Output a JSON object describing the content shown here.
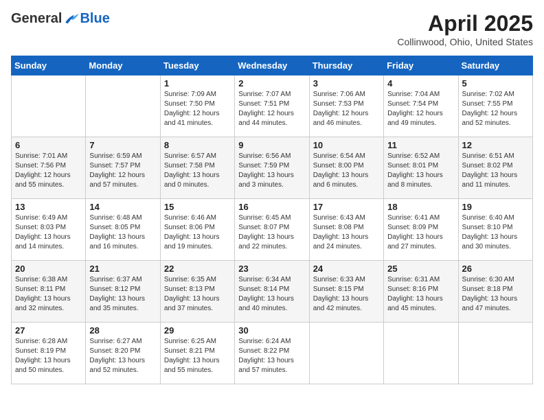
{
  "header": {
    "logo_general": "General",
    "logo_blue": "Blue",
    "month": "April 2025",
    "location": "Collinwood, Ohio, United States"
  },
  "weekdays": [
    "Sunday",
    "Monday",
    "Tuesday",
    "Wednesday",
    "Thursday",
    "Friday",
    "Saturday"
  ],
  "weeks": [
    [
      null,
      null,
      {
        "day": 1,
        "sunrise": "7:09 AM",
        "sunset": "7:50 PM",
        "daylight": "12 hours and 41 minutes."
      },
      {
        "day": 2,
        "sunrise": "7:07 AM",
        "sunset": "7:51 PM",
        "daylight": "12 hours and 44 minutes."
      },
      {
        "day": 3,
        "sunrise": "7:06 AM",
        "sunset": "7:53 PM",
        "daylight": "12 hours and 46 minutes."
      },
      {
        "day": 4,
        "sunrise": "7:04 AM",
        "sunset": "7:54 PM",
        "daylight": "12 hours and 49 minutes."
      },
      {
        "day": 5,
        "sunrise": "7:02 AM",
        "sunset": "7:55 PM",
        "daylight": "12 hours and 52 minutes."
      }
    ],
    [
      {
        "day": 6,
        "sunrise": "7:01 AM",
        "sunset": "7:56 PM",
        "daylight": "12 hours and 55 minutes."
      },
      {
        "day": 7,
        "sunrise": "6:59 AM",
        "sunset": "7:57 PM",
        "daylight": "12 hours and 57 minutes."
      },
      {
        "day": 8,
        "sunrise": "6:57 AM",
        "sunset": "7:58 PM",
        "daylight": "13 hours and 0 minutes."
      },
      {
        "day": 9,
        "sunrise": "6:56 AM",
        "sunset": "7:59 PM",
        "daylight": "13 hours and 3 minutes."
      },
      {
        "day": 10,
        "sunrise": "6:54 AM",
        "sunset": "8:00 PM",
        "daylight": "13 hours and 6 minutes."
      },
      {
        "day": 11,
        "sunrise": "6:52 AM",
        "sunset": "8:01 PM",
        "daylight": "13 hours and 8 minutes."
      },
      {
        "day": 12,
        "sunrise": "6:51 AM",
        "sunset": "8:02 PM",
        "daylight": "13 hours and 11 minutes."
      }
    ],
    [
      {
        "day": 13,
        "sunrise": "6:49 AM",
        "sunset": "8:03 PM",
        "daylight": "13 hours and 14 minutes."
      },
      {
        "day": 14,
        "sunrise": "6:48 AM",
        "sunset": "8:05 PM",
        "daylight": "13 hours and 16 minutes."
      },
      {
        "day": 15,
        "sunrise": "6:46 AM",
        "sunset": "8:06 PM",
        "daylight": "13 hours and 19 minutes."
      },
      {
        "day": 16,
        "sunrise": "6:45 AM",
        "sunset": "8:07 PM",
        "daylight": "13 hours and 22 minutes."
      },
      {
        "day": 17,
        "sunrise": "6:43 AM",
        "sunset": "8:08 PM",
        "daylight": "13 hours and 24 minutes."
      },
      {
        "day": 18,
        "sunrise": "6:41 AM",
        "sunset": "8:09 PM",
        "daylight": "13 hours and 27 minutes."
      },
      {
        "day": 19,
        "sunrise": "6:40 AM",
        "sunset": "8:10 PM",
        "daylight": "13 hours and 30 minutes."
      }
    ],
    [
      {
        "day": 20,
        "sunrise": "6:38 AM",
        "sunset": "8:11 PM",
        "daylight": "13 hours and 32 minutes."
      },
      {
        "day": 21,
        "sunrise": "6:37 AM",
        "sunset": "8:12 PM",
        "daylight": "13 hours and 35 minutes."
      },
      {
        "day": 22,
        "sunrise": "6:35 AM",
        "sunset": "8:13 PM",
        "daylight": "13 hours and 37 minutes."
      },
      {
        "day": 23,
        "sunrise": "6:34 AM",
        "sunset": "8:14 PM",
        "daylight": "13 hours and 40 minutes."
      },
      {
        "day": 24,
        "sunrise": "6:33 AM",
        "sunset": "8:15 PM",
        "daylight": "13 hours and 42 minutes."
      },
      {
        "day": 25,
        "sunrise": "6:31 AM",
        "sunset": "8:16 PM",
        "daylight": "13 hours and 45 minutes."
      },
      {
        "day": 26,
        "sunrise": "6:30 AM",
        "sunset": "8:18 PM",
        "daylight": "13 hours and 47 minutes."
      }
    ],
    [
      {
        "day": 27,
        "sunrise": "6:28 AM",
        "sunset": "8:19 PM",
        "daylight": "13 hours and 50 minutes."
      },
      {
        "day": 28,
        "sunrise": "6:27 AM",
        "sunset": "8:20 PM",
        "daylight": "13 hours and 52 minutes."
      },
      {
        "day": 29,
        "sunrise": "6:25 AM",
        "sunset": "8:21 PM",
        "daylight": "13 hours and 55 minutes."
      },
      {
        "day": 30,
        "sunrise": "6:24 AM",
        "sunset": "8:22 PM",
        "daylight": "13 hours and 57 minutes."
      },
      null,
      null,
      null
    ]
  ]
}
